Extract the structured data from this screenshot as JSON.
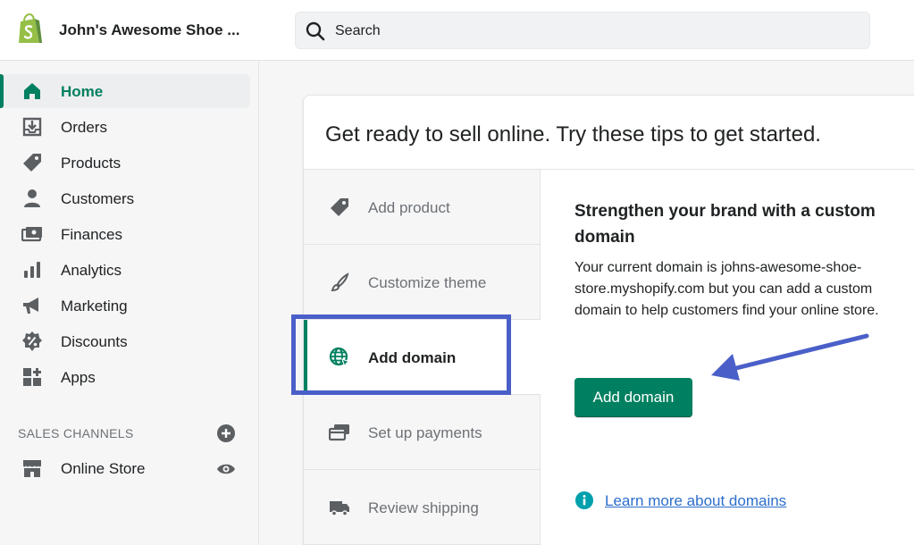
{
  "topbar": {
    "store_name": "John's Awesome Shoe ...",
    "search_placeholder": "Search"
  },
  "sidebar": {
    "items": [
      {
        "label": "Home",
        "icon": "home-icon",
        "active": true
      },
      {
        "label": "Orders",
        "icon": "orders-icon"
      },
      {
        "label": "Products",
        "icon": "tag-icon"
      },
      {
        "label": "Customers",
        "icon": "person-icon"
      },
      {
        "label": "Finances",
        "icon": "finances-icon"
      },
      {
        "label": "Analytics",
        "icon": "bar-chart-icon"
      },
      {
        "label": "Marketing",
        "icon": "megaphone-icon"
      },
      {
        "label": "Discounts",
        "icon": "discount-icon"
      },
      {
        "label": "Apps",
        "icon": "apps-icon"
      }
    ],
    "sales_channels_title": "SALES CHANNELS",
    "channels": [
      {
        "label": "Online Store",
        "icon": "store-icon"
      }
    ]
  },
  "card": {
    "title": "Get ready to sell online. Try these tips to get started.",
    "tabs": [
      {
        "label": "Add product",
        "icon": "tag-icon"
      },
      {
        "label": "Customize theme",
        "icon": "brush-icon"
      },
      {
        "label": "Add domain",
        "icon": "globe-icon",
        "active": true
      },
      {
        "label": "Set up payments",
        "icon": "payments-icon"
      },
      {
        "label": "Review shipping",
        "icon": "truck-icon"
      }
    ],
    "detail": {
      "title": "Strengthen your brand with a custom domain",
      "body": "Your current domain is johns-awesome-shoe-store.myshopify.com but you can add a custom domain to help customers find your online store.",
      "button_label": "Add domain",
      "link_label": "Learn more about domains"
    }
  },
  "colors": {
    "accent_green": "#008060",
    "highlight_blue": "#4a5fc8",
    "link_blue": "#2c6ecb",
    "info_teal": "#00a0ac"
  }
}
